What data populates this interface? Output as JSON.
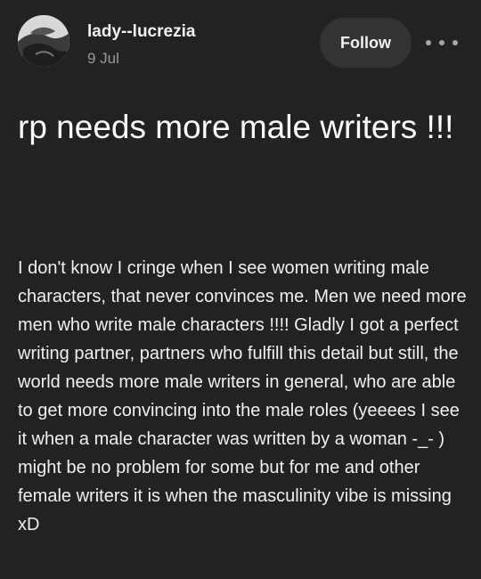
{
  "post": {
    "author": {
      "username": "lady--lucrezia",
      "avatar_icon": "avatar-photo"
    },
    "date": "9 Jul",
    "follow_label": "Follow",
    "more_icon": "ellipsis-icon",
    "title": "rp needs more male writers !!!",
    "body": "I don't know I cringe when I see women writing male characters, that never convinces me. Men we need more men who write male characters !!!! Gladly I got a perfect writing partner, partners who fulfill this detail but still, the world needs more male writers in general, who are able to get more convincing into the male roles (yeeees I see it when a male character was written by a woman -_- ) might be no problem for some but for me and other female writers it is when the masculinity vibe is missing xD"
  },
  "colors": {
    "background": "#222222",
    "button_bg": "#333333",
    "muted_text": "#9a9a9a"
  }
}
